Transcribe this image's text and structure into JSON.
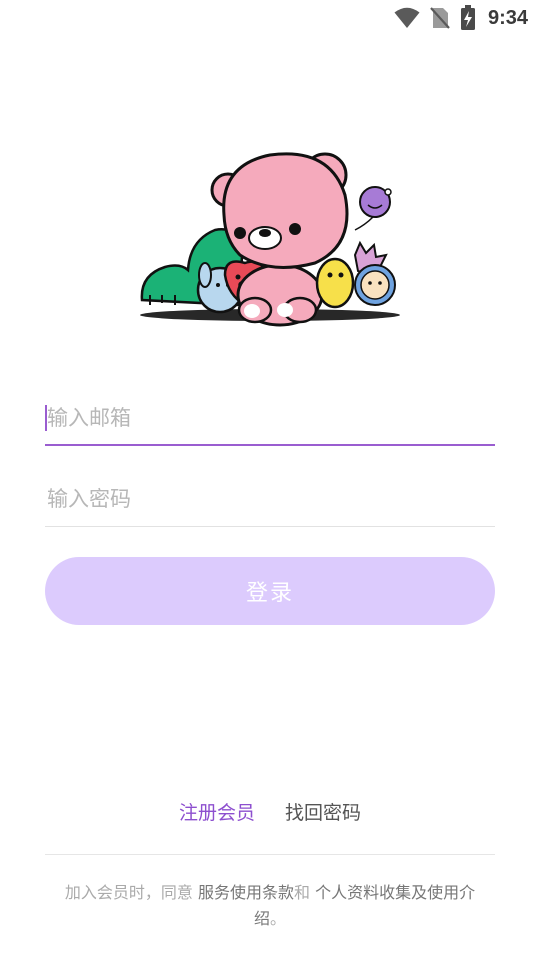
{
  "status_bar": {
    "time": "9:34",
    "icons": [
      "wifi-icon",
      "no-sim-icon",
      "battery-charging-icon"
    ]
  },
  "hero": {
    "icon": "mascot-characters-illustration"
  },
  "form": {
    "email_placeholder": "输入邮箱",
    "password_placeholder": "输入密码",
    "login_label": "登录"
  },
  "links": {
    "register": "注册会员",
    "forgot_password": "找回密码"
  },
  "terms": {
    "prefix": "加入会员时，同意 ",
    "service_terms": "服务使用条款",
    "and": "和 ",
    "privacy": "个人资料收集及使用介绍",
    "suffix": "。"
  },
  "colors": {
    "accent": "#9a5dd0",
    "button_bg": "#dccbfd",
    "register_link": "#8d4fcf"
  }
}
